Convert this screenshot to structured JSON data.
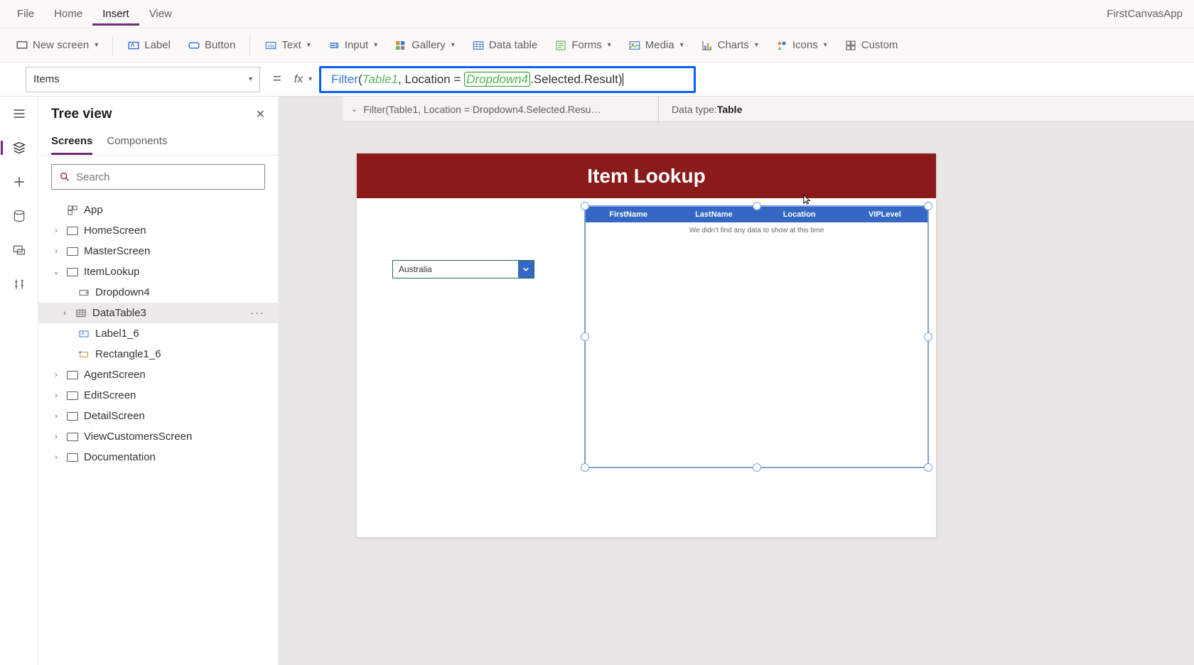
{
  "app_title": "FirstCanvasApp",
  "menubar": {
    "file": "File",
    "home": "Home",
    "insert": "Insert",
    "view": "View"
  },
  "ribbon": {
    "new_screen": "New screen",
    "label": "Label",
    "button": "Button",
    "text": "Text",
    "input": "Input",
    "gallery": "Gallery",
    "data_table": "Data table",
    "forms": "Forms",
    "media": "Media",
    "charts": "Charts",
    "icons": "Icons",
    "custom": "Custom"
  },
  "property_selector": "Items",
  "formula": {
    "fn": "Filter",
    "p1": "(",
    "arg1": "Table1",
    "comma1": ", Location = ",
    "dd": "Dropdown4",
    "tail": ".Selected.Result",
    "p2": ")"
  },
  "formula_result_text": "Filter(Table1, Location = Dropdown4.Selected.Resu…",
  "data_type_label": "Data type: ",
  "data_type_value": "Table",
  "tree": {
    "title": "Tree view",
    "tab_screens": "Screens",
    "tab_components": "Components",
    "search_placeholder": "Search",
    "app": "App",
    "items": [
      "HomeScreen",
      "MasterScreen",
      "ItemLookup",
      "AgentScreen",
      "EditScreen",
      "DetailScreen",
      "ViewCustomersScreen",
      "Documentation"
    ],
    "itemlookup_children": {
      "dropdown": "Dropdown4",
      "datatable": "DataTable3",
      "label": "Label1_6",
      "rect": "Rectangle1_6"
    }
  },
  "canvas": {
    "header": "Item Lookup",
    "dropdown_value": "Australia",
    "table_columns": [
      "FirstName",
      "LastName",
      "Location",
      "VIPLevel"
    ],
    "table_empty_msg": "We didn't find any data to show at this time"
  }
}
